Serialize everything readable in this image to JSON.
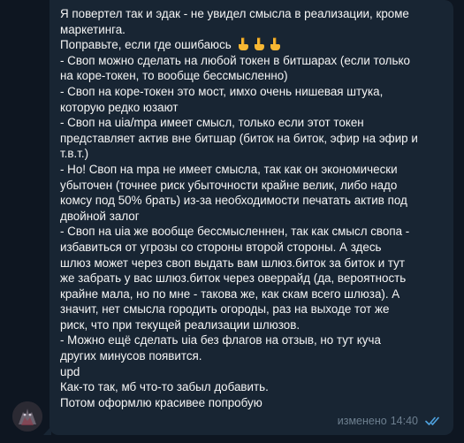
{
  "message": {
    "lines": [
      "Я повертел так и эдак - не увидел смысла в реализации, кроме",
      "маркетинга.",
      "Поправьте, если где ошибаюсь",
      "- Своп можно сделать на любой токен в битшарах (если только",
      "на коре-токен, то вообще бессмысленно)",
      "- Своп на коре-токен это мост, имхо очень нишевая штука,",
      "которую редко юзают",
      "- Своп на uia/mpa имеет смысл, только если этот токен",
      "представляет актив вне битшар (биток на биток, эфир на эфир и",
      "т.в.т.)",
      "- Но! Своп на mpa не имеет смысла, так как он экономически",
      "убыточен (точнее риск убыточности крайне велик, либо надо",
      "комсу под 50% брать) из-за необходимости печатать актив под",
      "двойной залог",
      "- Своп на uia же вообще бессмысленнен, так как смысл свопа -",
      "избавиться от угрозы со стороны второй стороны. А здесь",
      "шлюз может через своп выдать вам шлюз.биток за биток и тут",
      "же забрать у вас шлюз.биток через оверрайд (да, вероятность",
      "крайне мала, но по мне - такова же, как скам всего шлюза). А",
      "значит, нет смысла городить огороды, раз на выходе тот же",
      "риск, что при текущей реализации шлюзов.",
      "- Можно ещё сделать uia без флагов на отзыв, но тут куча",
      "других минусов появится.",
      "upd",
      "Как-то так, мб что-то забыл добавить.",
      "Потом оформлю красивее попробую"
    ],
    "emoji": [
      "pointing-down-hand",
      "pointing-down-hand",
      "pointing-down-hand"
    ],
    "edited_label": "изменено",
    "time": "14:40",
    "status_icon": "double-check-read"
  },
  "colors": {
    "background": "#0e1621",
    "bubble": "#182533",
    "text": "#f5f5f5",
    "meta": "#6d7f8f",
    "check": "#4fa3e0"
  }
}
